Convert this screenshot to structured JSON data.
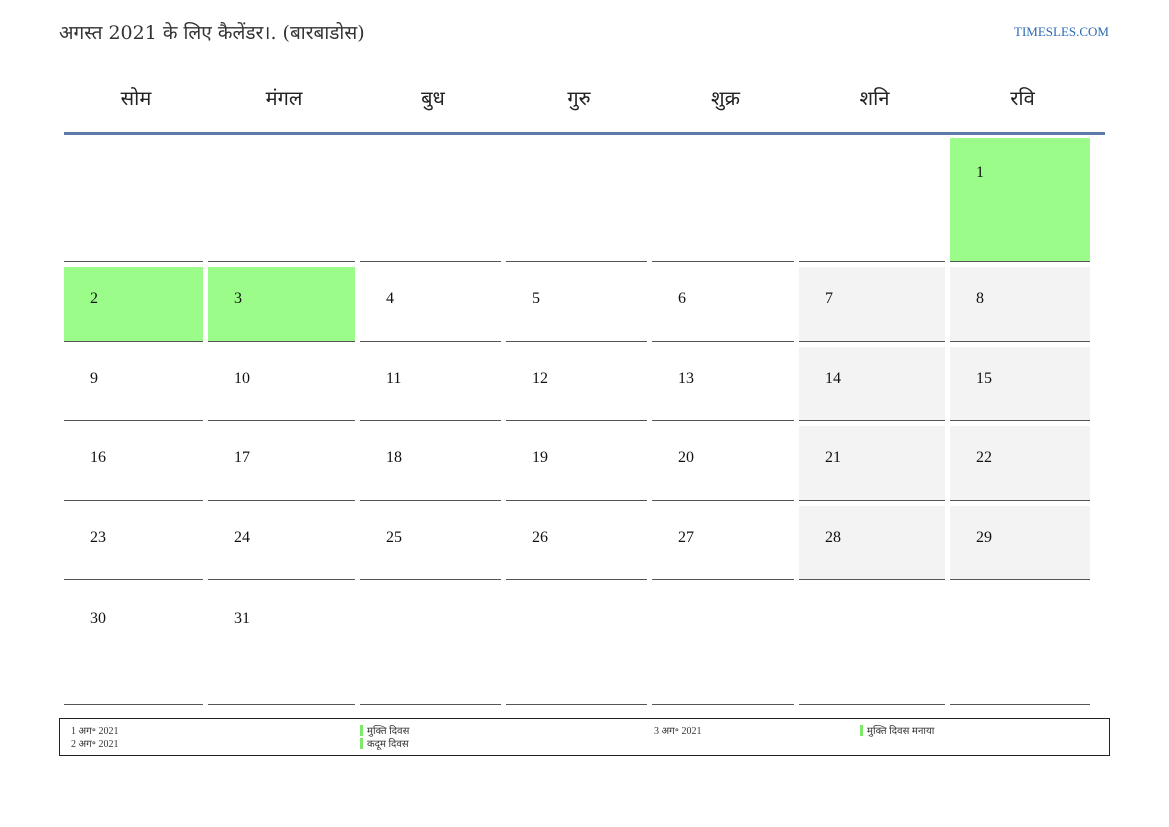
{
  "header": {
    "title": "अगस्त 2021 के लिए कैलेंडर।. (बारबाडोस)",
    "site": "TIMESLES.COM"
  },
  "weekdays": [
    "सोम",
    "मंगल",
    "बुध",
    "गुरु",
    "शुक्र",
    "शनि",
    "रवि"
  ],
  "weeks": [
    [
      "",
      "",
      "",
      "",
      "",
      "",
      "1"
    ],
    [
      "2",
      "3",
      "4",
      "5",
      "6",
      "7",
      "8"
    ],
    [
      "9",
      "10",
      "11",
      "12",
      "13",
      "14",
      "15"
    ],
    [
      "16",
      "17",
      "18",
      "19",
      "20",
      "21",
      "22"
    ],
    [
      "23",
      "24",
      "25",
      "26",
      "27",
      "28",
      "29"
    ],
    [
      "30",
      "31",
      "",
      "",
      "",
      "",
      ""
    ]
  ],
  "holidays": [
    "1",
    "2",
    "3"
  ],
  "colors": {
    "holiday": "#9cfc8a",
    "weekend": "#f3f3f3",
    "header_rule": "#5b7aa6",
    "link": "#2a6ab3"
  },
  "legend": [
    {
      "date": "1 अग॰ 2021",
      "name": "मुक्ति दिवस"
    },
    {
      "date": "2 अग॰ 2021",
      "name": "कदूम दिवस"
    },
    {
      "date": "3 अग॰ 2021",
      "name": "मुक्ति दिवस मनाया"
    }
  ]
}
